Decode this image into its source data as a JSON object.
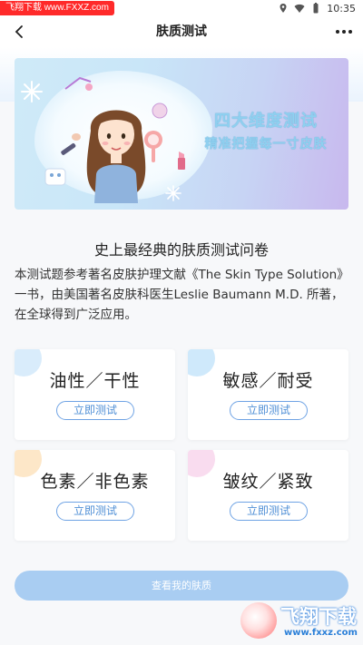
{
  "status_bar": {
    "watermark": "飞翔下载 www.FXXZ.com",
    "time": "10:35"
  },
  "header": {
    "title": "肤质测试"
  },
  "banner": {
    "line1": "四大维度测试",
    "line2": "精准把握每一寸皮肤"
  },
  "intro": {
    "title": "史上最经典的肤质测试问卷",
    "body": "本测试题参考著名皮肤护理文献《The Skin Type Solution》一书，由美国著名皮肤科医生Leslie Baumann M.D. 所著，在全球得到广泛应用。"
  },
  "cards": [
    {
      "title": "油性／干性",
      "button": "立即测试",
      "deco_color": "#d9ecfb"
    },
    {
      "title": "敏感／耐受",
      "button": "立即测试",
      "deco_color": "#cfe9fb"
    },
    {
      "title": "色素／非色素",
      "button": "立即测试",
      "deco_color": "#fde7c8"
    },
    {
      "title": "皱纹／紧致",
      "button": "立即测试",
      "deco_color": "#f9dcef"
    }
  ],
  "bottom_button": {
    "label": "查看我的肤质"
  },
  "watermark_bottom": {
    "brand": "飞翔下载",
    "url": "www.fxxz.com"
  },
  "colors": {
    "accent": "#4f8fd6",
    "bottom_button_bg": "#a9cdf2",
    "banner_text": "#8fd0f0"
  }
}
